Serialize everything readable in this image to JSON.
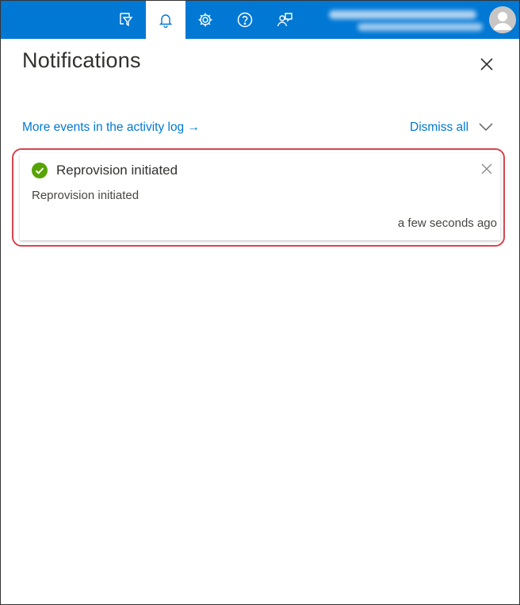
{
  "topbar": {
    "icons": [
      {
        "name": "directory-filter-icon",
        "active": false
      },
      {
        "name": "bell-icon",
        "active": true
      },
      {
        "name": "gear-icon",
        "active": false
      },
      {
        "name": "help-icon",
        "active": false
      },
      {
        "name": "feedback-icon",
        "active": false
      }
    ],
    "brand_color": "#0078d4"
  },
  "panel": {
    "title": "Notifications",
    "activity_link": "More events in the activity log →",
    "dismiss_all": "Dismiss all"
  },
  "notifications": [
    {
      "status": "success",
      "status_color": "#57a300",
      "title": "Reprovision initiated",
      "body": "Reprovision initiated",
      "time": "a few seconds ago"
    }
  ],
  "highlight_color": "#d9434e"
}
